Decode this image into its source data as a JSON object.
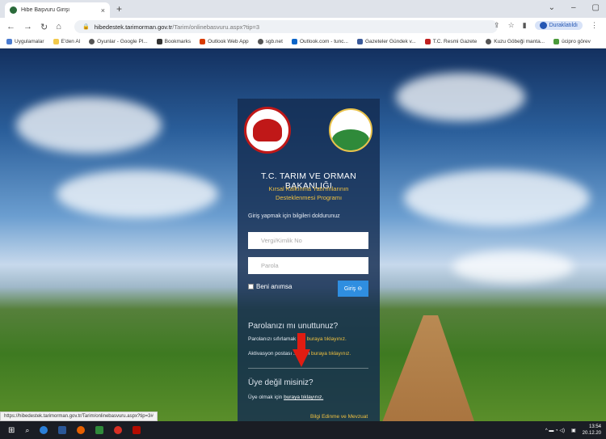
{
  "browser": {
    "tab_title": "Hibe Başvuru Girişi",
    "tab_close": "×",
    "new_tab": "+",
    "url_domain": "hibedestek.tarimorman.gov.tr",
    "url_path": "/Tarim/onlinebasvuru.aspx?tip=3",
    "profile_label": "Duraklatıldı",
    "status_url": "https://hibedestek.tarimorman.gov.tr/Tarim/onlinebasvuru.aspx?tip=3#",
    "bookmarks": [
      "Uygulamalar",
      "E'den Al",
      "Oyunlar - Google Pl...",
      "Bookmarks",
      "Outlook Web App",
      "sgb.net",
      "Outlook.com - tunc...",
      "Gazeteler Gündek v...",
      "T.C. Resmi Gazete",
      "Kuzu Göbeği manta...",
      "ücipro görev"
    ]
  },
  "panel": {
    "ministry": "T.C. TARIM VE ORMAN BAKANLIĞI",
    "program_line1": "Kırsal Kalkınma Yatırımlarının",
    "program_line2": "Desteklenmesi Programı",
    "hint": "Giriş yapmak için bilgileri doldurunuz",
    "tax_placeholder": "Vergi/Kimlik No",
    "password_placeholder": "Parola",
    "remember": "Beni anımsa",
    "login_button": "Giriş",
    "forgot_title": "Parolanızı mı unuttunuz?",
    "reset_text": "Parolanızı sıfırlamak için ",
    "reset_link": "buraya tıklayınız.",
    "activate_text": "Aktivasyon postası ...k için ",
    "activate_link": "buraya tıklayınız.",
    "member_title": "Üye değil misiniz?",
    "member_text": "Üye olmak için ",
    "member_link": "buraya tıklayınız.",
    "footer_link": "Bilgi Edinme ve Mevzuat"
  },
  "taskbar": {
    "time": "13:54",
    "date": "20.12.20"
  },
  "colors": {
    "accent_yellow": "#f0c140",
    "login_button": "#2f8ee0",
    "arrow": "#e01c12",
    "panel_bg": "#142c50"
  }
}
